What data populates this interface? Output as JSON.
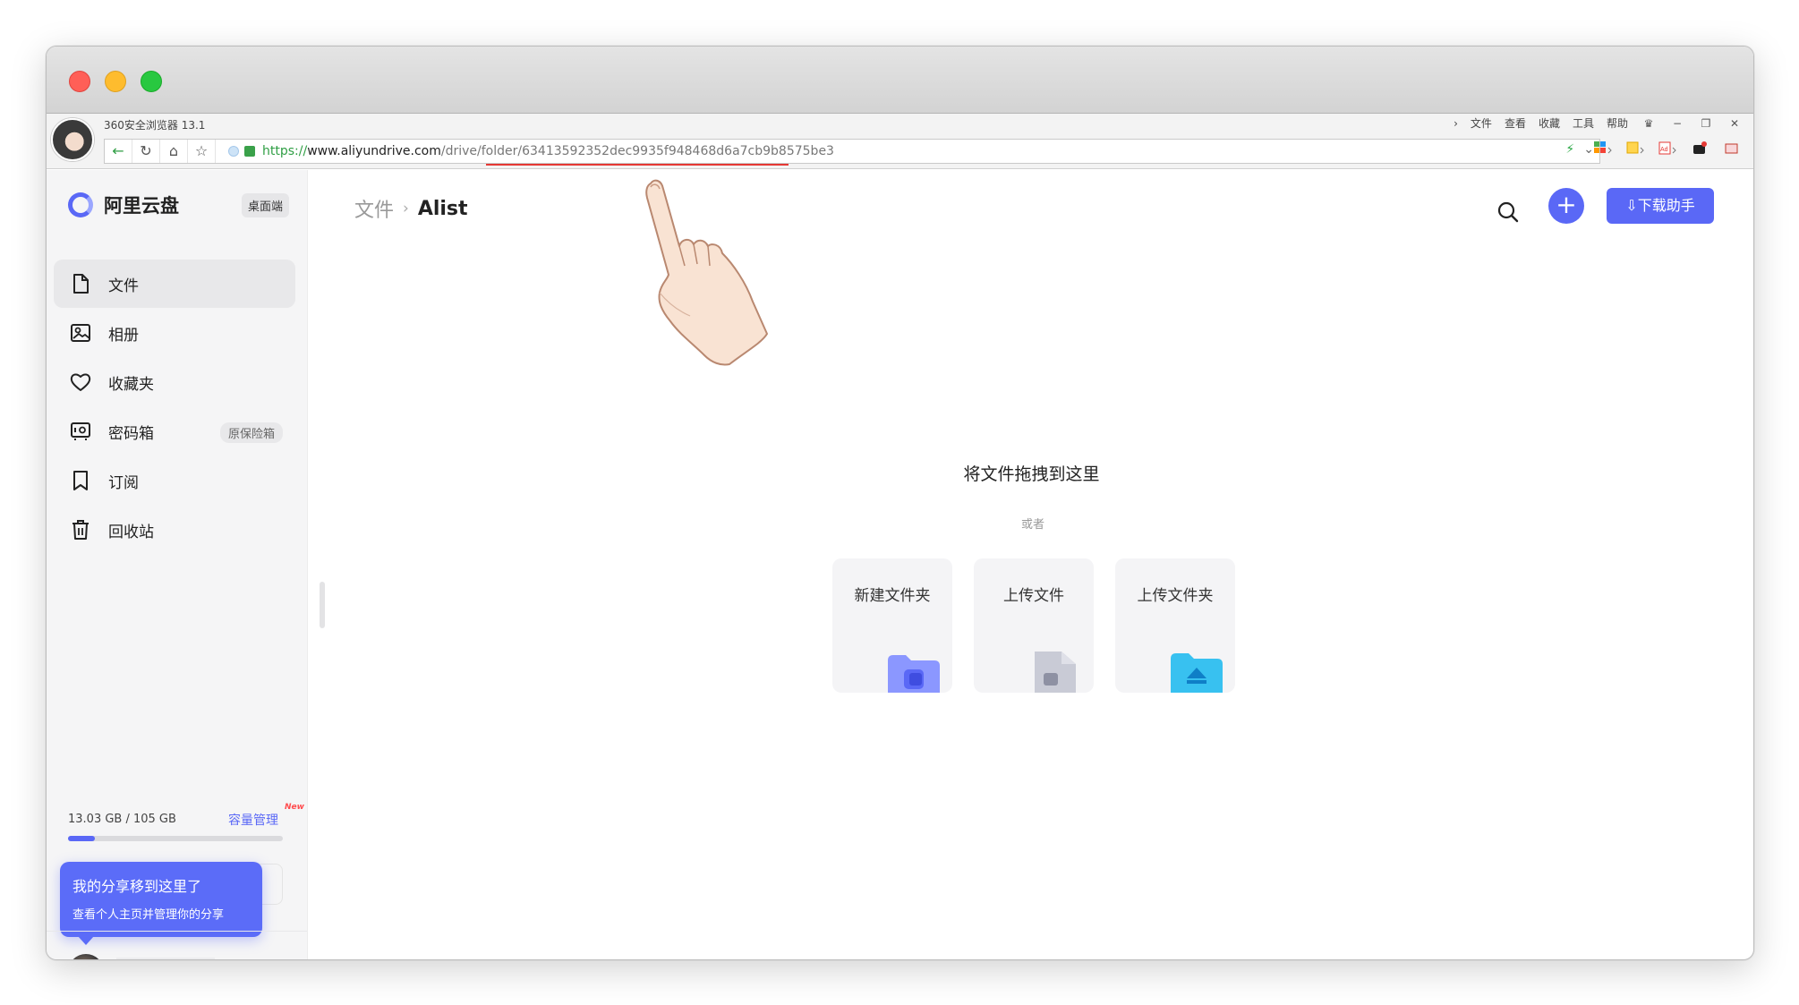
{
  "browser": {
    "version_label": "360安全浏览器 13.1",
    "menu": [
      "文件",
      "查看",
      "收藏",
      "工具",
      "帮助"
    ],
    "url_protocol": "https://",
    "url_domain": "www.aliyundrive.com",
    "url_path": "/drive/folder/63413592352dec9935f948468d6a7cb9b8575be3"
  },
  "app": {
    "brand": "阿里云盘",
    "desktop_badge": "桌面端",
    "nav": [
      {
        "label": "文件",
        "icon": "file-icon",
        "active": true
      },
      {
        "label": "相册",
        "icon": "album-icon",
        "active": false
      },
      {
        "label": "收藏夹",
        "icon": "heart-icon",
        "active": false
      },
      {
        "label": "密码箱",
        "icon": "safe-icon",
        "active": false,
        "tag": "原保险箱"
      },
      {
        "label": "订阅",
        "icon": "bookmark-icon",
        "active": false
      },
      {
        "label": "回收站",
        "icon": "trash-icon",
        "active": false
      }
    ],
    "storage": {
      "used_label": "13.03 GB / 105 GB",
      "used_fraction": 0.124,
      "manage_link": "容量管理",
      "new_badge": "New"
    },
    "share_tip": {
      "title": "我的分享移到这里了",
      "subtitle": "查看个人主页并管理你的分享"
    }
  },
  "main": {
    "breadcrumb_root": "文件",
    "breadcrumb_current": "Alist",
    "download_button": "下载助手",
    "drop_title": "将文件拖拽到这里",
    "drop_or": "或者",
    "actions": [
      {
        "label": "新建文件夹",
        "icon": "new-folder-icon"
      },
      {
        "label": "上传文件",
        "icon": "upload-file-icon"
      },
      {
        "label": "上传文件夹",
        "icon": "upload-folder-icon"
      }
    ]
  },
  "colors": {
    "accent": "#5a68f6",
    "sidebar_bg": "#f5f5f6",
    "url_highlight": "#e53935"
  }
}
